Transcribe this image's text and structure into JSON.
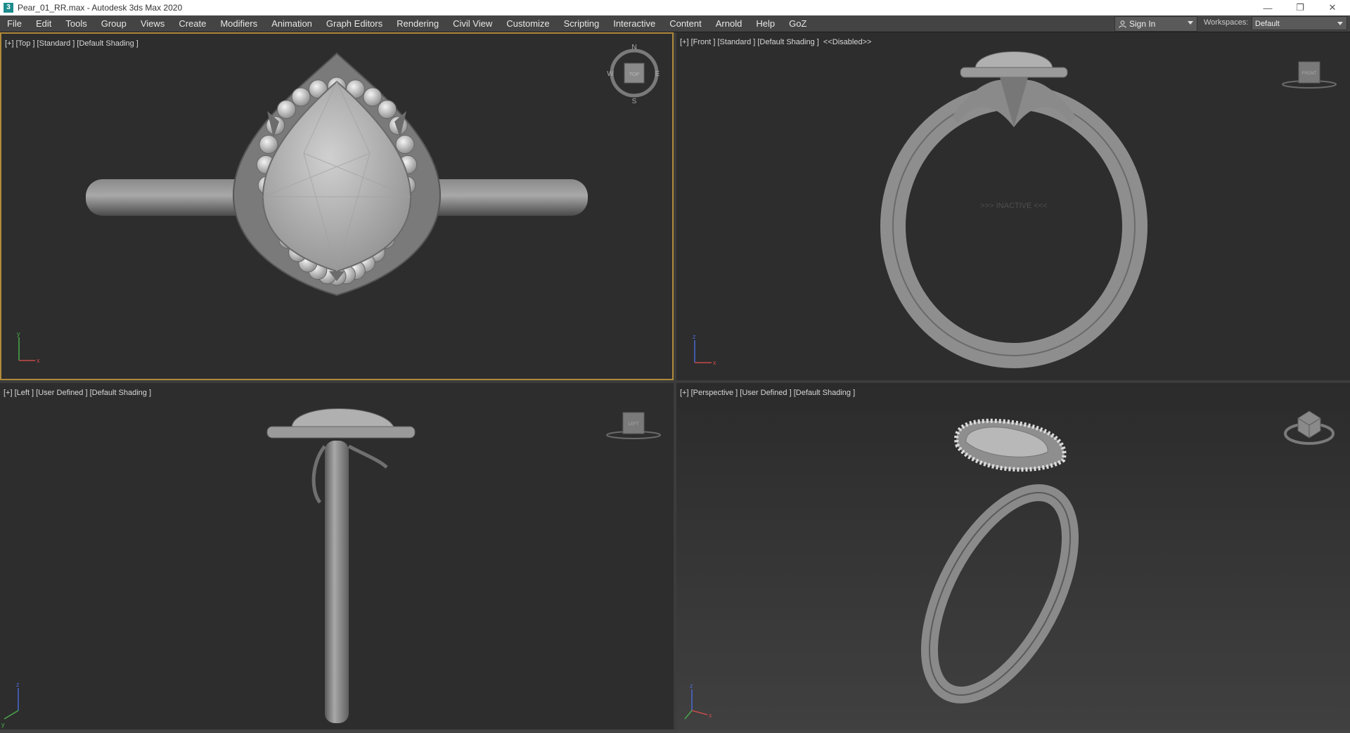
{
  "window": {
    "title": "Pear_01_RR.max - Autodesk 3ds Max 2020",
    "app_icon_glyph": "3",
    "controls": [
      "minimize-icon",
      "restore-icon",
      "close-icon"
    ]
  },
  "menubar": {
    "items": [
      "File",
      "Edit",
      "Tools",
      "Group",
      "Views",
      "Create",
      "Modifiers",
      "Animation",
      "Graph Editors",
      "Rendering",
      "Civil View",
      "Customize",
      "Scripting",
      "Interactive",
      "Content",
      "Arnold",
      "Help",
      "GoZ"
    ],
    "sign_in": "Sign In",
    "workspaces_label": "Workspaces:",
    "workspaces_value": "Default"
  },
  "viewports": {
    "top": {
      "label": "[+] [Top ] [Standard ] [Default Shading ]",
      "compass": {
        "n": "N",
        "s": "S",
        "e": "E",
        "w": "W",
        "cube": "TOP"
      },
      "axis": {
        "y": "y",
        "x": "x"
      }
    },
    "front": {
      "label": "[+] [Front ] [Standard ] [Default Shading ]  <<Disabled>>",
      "inactive_text": ">>> INACTIVE <<<",
      "cube": "FRONT",
      "axis": {
        "y": "z",
        "x": "x"
      }
    },
    "left": {
      "label": "[+] [Left ] [User Defined ] [Default Shading ]",
      "cube": "LEFT",
      "axis": {
        "y": "z",
        "x": "y"
      }
    },
    "perspective": {
      "label": "[+] [Perspective ] [User Defined ] [Default Shading ]",
      "axis": {
        "y": "z",
        "x": "x"
      }
    }
  },
  "colors": {
    "active_viewport_border": "#b08a3a",
    "viewport_bg": "#2d2d2d",
    "menubar_bg": "#444444"
  }
}
